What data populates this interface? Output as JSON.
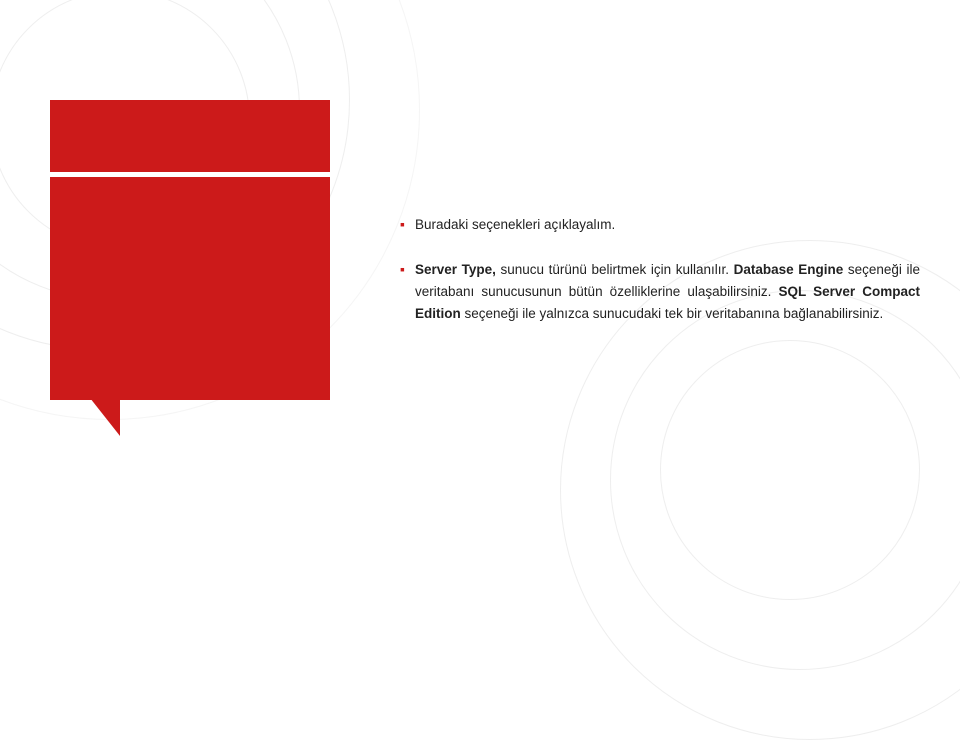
{
  "background": {
    "color": "#ffffff"
  },
  "accent_color": "#cc1a1a",
  "bullet_icon": "▪",
  "bullets": [
    {
      "id": "bullet-1",
      "text_plain": "Buradaki seçenekleri açıklayalım.",
      "bold_parts": [],
      "text_html": "Buradaki seçenekleri açıklayalım."
    },
    {
      "id": "bullet-2",
      "text_plain": "Server Type, sunucu türünü belirtmek için kullanılır. Database Engine seçeneği ile veritabanı sunucusunun bütün özelliklerine ulaşabilirsiniz. SQL Server Compact Edition seçeneği ile yalnızca sunucudaki tek bir veritabanına bağlanabilirsiniz.",
      "text_html": "<b>Server Type,</b> sunucu türünü belirtmek için kullanılır. <b>Database Engine</b> seçeneği ile veritabanı sunucusunun bütün özelliklerine ulaşabilirsiniz. <b>SQL Server Compact Edition</b> seçeneği ile yalnızca sunucudaki tek bir veritabanına bağlanabilirsiniz."
    }
  ]
}
